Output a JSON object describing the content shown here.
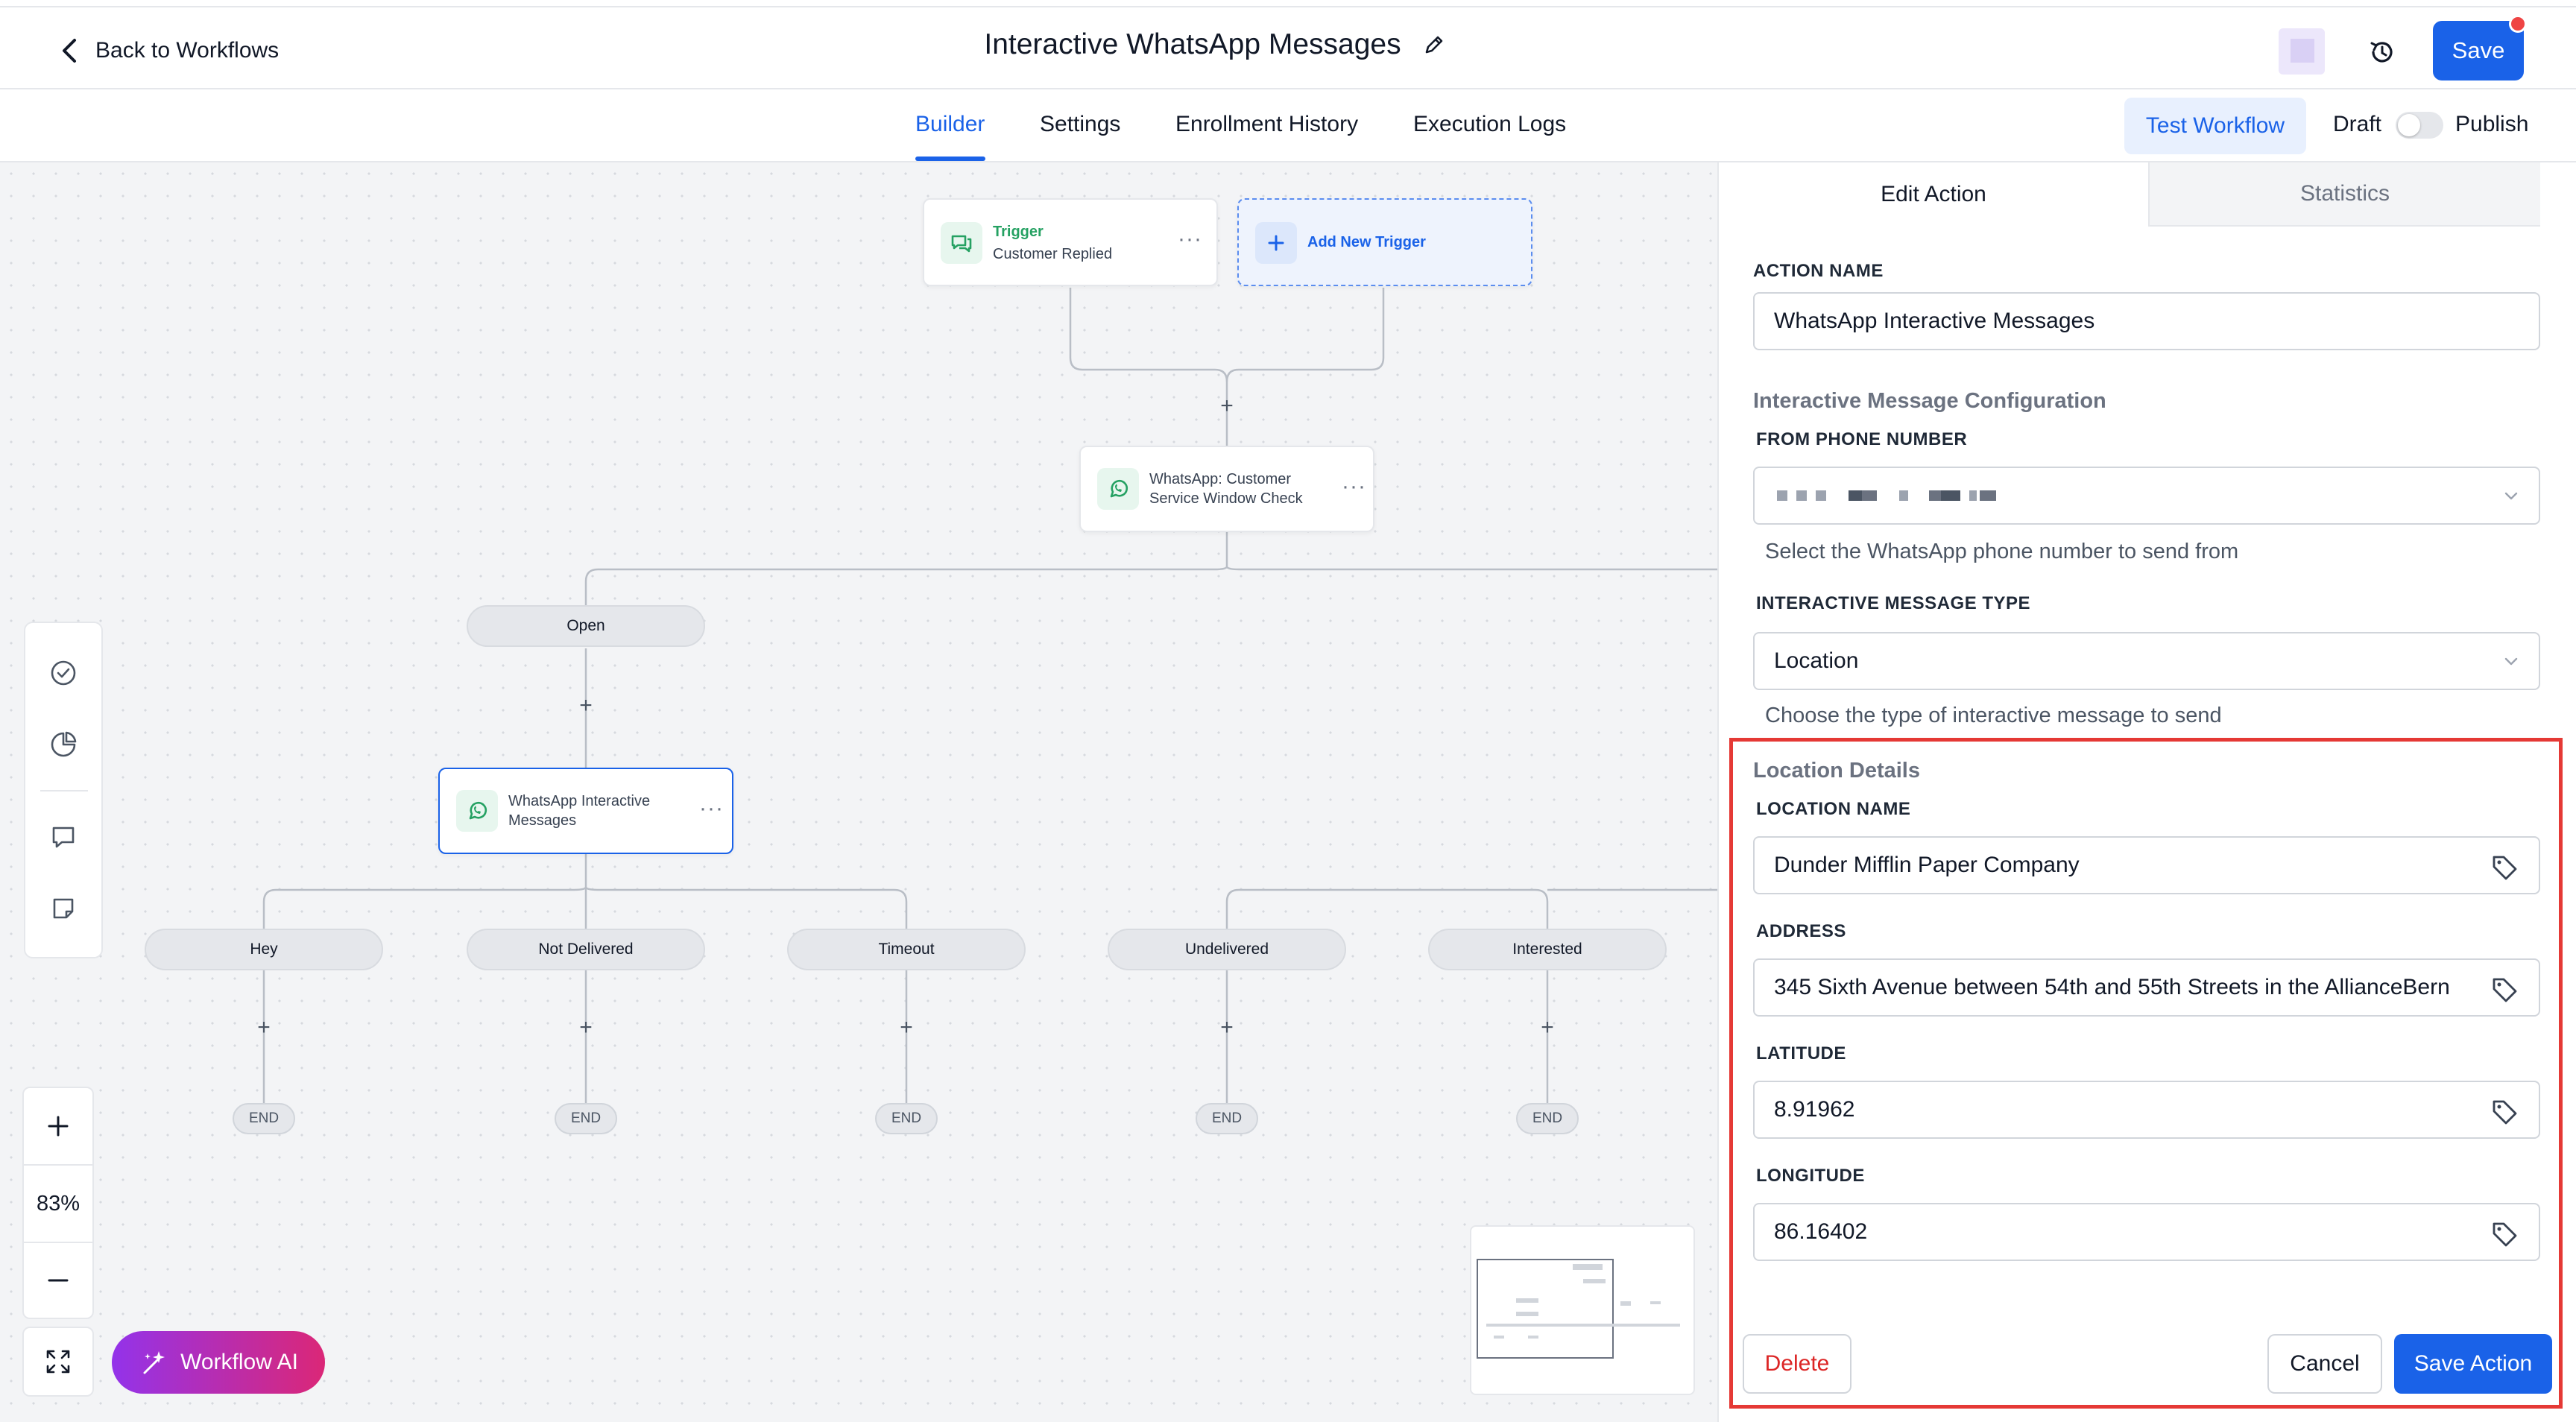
{
  "header": {
    "back_label": "Back to Workflows",
    "title": "Interactive WhatsApp Messages",
    "save_label": "Save"
  },
  "tabs": [
    "Builder",
    "Settings",
    "Enrollment History",
    "Execution Logs"
  ],
  "toolbar": {
    "test_label": "Test Workflow",
    "draft_label": "Draft",
    "publish_label": "Publish"
  },
  "canvas": {
    "trigger": {
      "kicker": "Trigger",
      "name": "Customer Replied"
    },
    "add_trigger_label": "Add New Trigger",
    "window_check": {
      "line1": "WhatsApp: Customer",
      "line2": "Service Window Check"
    },
    "branch_open": "Open",
    "interactive_node": {
      "line1": "WhatsApp Interactive",
      "line2": "Messages"
    },
    "branches": [
      "Hey",
      "Not Delivered",
      "Timeout",
      "Undelivered",
      "Interested"
    ],
    "end_label": "END",
    "zoom": "83%",
    "ai_label": "Workflow AI"
  },
  "panel": {
    "tabs": [
      "Edit Action",
      "Statistics"
    ],
    "action_name_label": "ACTION NAME",
    "action_name_value": "WhatsApp Interactive Messages",
    "config_section": "Interactive Message Configuration",
    "from_phone_label": "FROM PHONE NUMBER",
    "from_phone_help": "Select the WhatsApp phone number to send from",
    "type_label": "INTERACTIVE MESSAGE TYPE",
    "type_value": "Location",
    "type_help": "Choose the type of interactive message to send",
    "location_section": "Location Details",
    "location_name_label": "LOCATION NAME",
    "location_name_value": "Dunder Mifflin Paper Company",
    "address_label": "ADDRESS",
    "address_value": "345 Sixth Avenue between 54th and 55th Streets in the AllianceBern",
    "latitude_label": "LATITUDE",
    "latitude_value": "8.91962",
    "longitude_label": "LONGITUDE",
    "longitude_value": "86.16402",
    "delete_label": "Delete",
    "cancel_label": "Cancel",
    "save_action_label": "Save Action"
  },
  "colors": {
    "accent": "#1a62e8",
    "whatsapp_green": "#25a162",
    "highlight_red": "#e53935",
    "delete_red": "#dc2626"
  }
}
